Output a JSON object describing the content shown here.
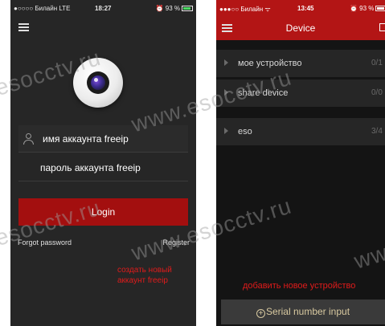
{
  "left_screen": {
    "status_bar": {
      "carrier": "●○○○○ Билайн  LTE",
      "time": "18:27",
      "battery": "⏰ 93 %"
    },
    "username": {
      "placeholder": "имя аккаунта freeip"
    },
    "password": {
      "placeholder": "пароль аккаунта freeip"
    },
    "login_label": "Login",
    "forgot_label": "Forgot password",
    "register_label": "Register",
    "annotation": "создать новый аккаунт freeip"
  },
  "right_screen": {
    "status_bar": {
      "carrier": "●●●○○ Билайн  ᯤ",
      "time": "13:45",
      "battery": "⏰ 93 %"
    },
    "title": "Device",
    "devices": [
      {
        "name": "мое устройство",
        "count": "0/1"
      },
      {
        "name": "share device",
        "count": "0/0"
      },
      {
        "name": "eso",
        "count": "3/4"
      }
    ],
    "annotation": "добавить новое устройство",
    "serial_button_label": "Serial number input"
  },
  "watermarks": {
    "site_short": "esocctv.ru",
    "site_full": "www.esocctv.ru",
    "www": "www."
  },
  "colors": {
    "brand_red": "#b31515",
    "login_red": "#a30f0f",
    "annotation_red": "#e11b1b"
  }
}
